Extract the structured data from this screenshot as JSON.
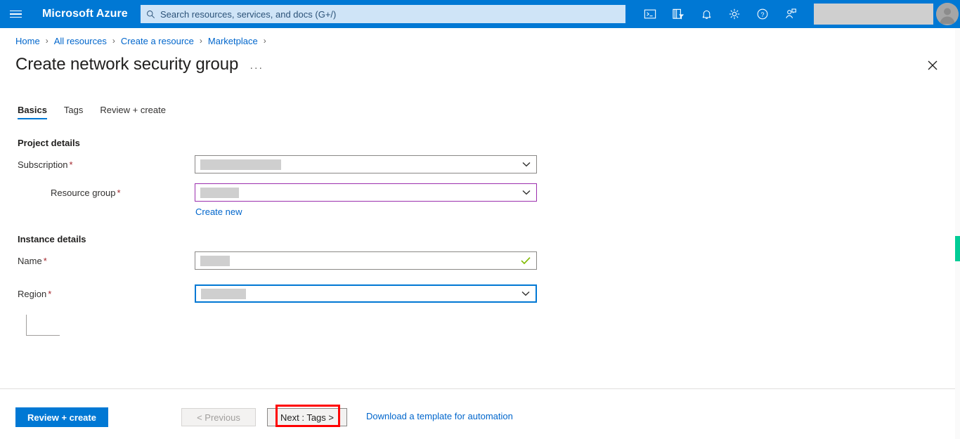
{
  "topnav": {
    "menu_icon": "hamburger-icon",
    "brand": "Microsoft Azure",
    "search_placeholder": "Search resources, services, and docs (G+/)",
    "search_icon": "search-icon",
    "icons": [
      {
        "name": "cloud-shell-icon",
        "label": "Cloud Shell"
      },
      {
        "name": "directory-filter-icon",
        "label": "Directories + subscriptions"
      },
      {
        "name": "notifications-bell-icon",
        "label": "Notifications"
      },
      {
        "name": "settings-gear-icon",
        "label": "Settings"
      },
      {
        "name": "help-question-icon",
        "label": "Help"
      },
      {
        "name": "feedback-person-icon",
        "label": "Feedback"
      }
    ],
    "account_redacted": "",
    "avatar_icon": "avatar-icon",
    "accent_color": "#0078d4",
    "search_bg": "#cfe4f7"
  },
  "breadcrumb": {
    "items": [
      "Home",
      "All resources",
      "Create a resource",
      "Marketplace"
    ],
    "separator": "›",
    "link_color": "#0066cc"
  },
  "header": {
    "title": "Create network security group",
    "more_menu": "···",
    "close_icon": "close-icon"
  },
  "tabs": [
    {
      "label": "Basics",
      "active": true
    },
    {
      "label": "Tags",
      "active": false
    },
    {
      "label": "Review + create",
      "active": false
    }
  ],
  "form": {
    "sections": [
      {
        "heading": "Project details",
        "fields": [
          {
            "label": "Subscription",
            "required_mark": "*",
            "type": "dropdown",
            "value": "",
            "redacted": true,
            "redact_width": 115,
            "state": "normal",
            "icon": "chevron-down-icon"
          },
          {
            "label": "Resource group",
            "required_mark": "*",
            "type": "dropdown",
            "value": "",
            "redacted": true,
            "redact_width": 55,
            "state": "purple",
            "icon": "chevron-down-icon",
            "indented": true,
            "sub_link": "Create new"
          }
        ]
      },
      {
        "heading": "Instance details",
        "fields": [
          {
            "label": "Name",
            "required_mark": "*",
            "type": "text",
            "value": "",
            "redacted": true,
            "redact_width": 42,
            "state": "valid",
            "icon": "checkmark-icon"
          },
          {
            "label": "Region",
            "required_mark": "*",
            "type": "dropdown",
            "value": "",
            "redacted": true,
            "redact_width": 64,
            "state": "focused",
            "icon": "chevron-down-icon"
          }
        ]
      }
    ],
    "required_color": "#a4262c",
    "purple_border": "#9b2fae",
    "focus_border": "#0078d4",
    "valid_check_color": "#7fba00"
  },
  "footer": {
    "review_create_label": "Review + create",
    "previous_label": "< Previous",
    "next_label": "Next : Tags >",
    "download_template_label": "Download a template for automation",
    "highlight_color": "#ff0000",
    "highlighted_button": "Next : Tags >"
  },
  "scrollbar": {
    "thumb_color": "#00cc96",
    "position": "right"
  }
}
